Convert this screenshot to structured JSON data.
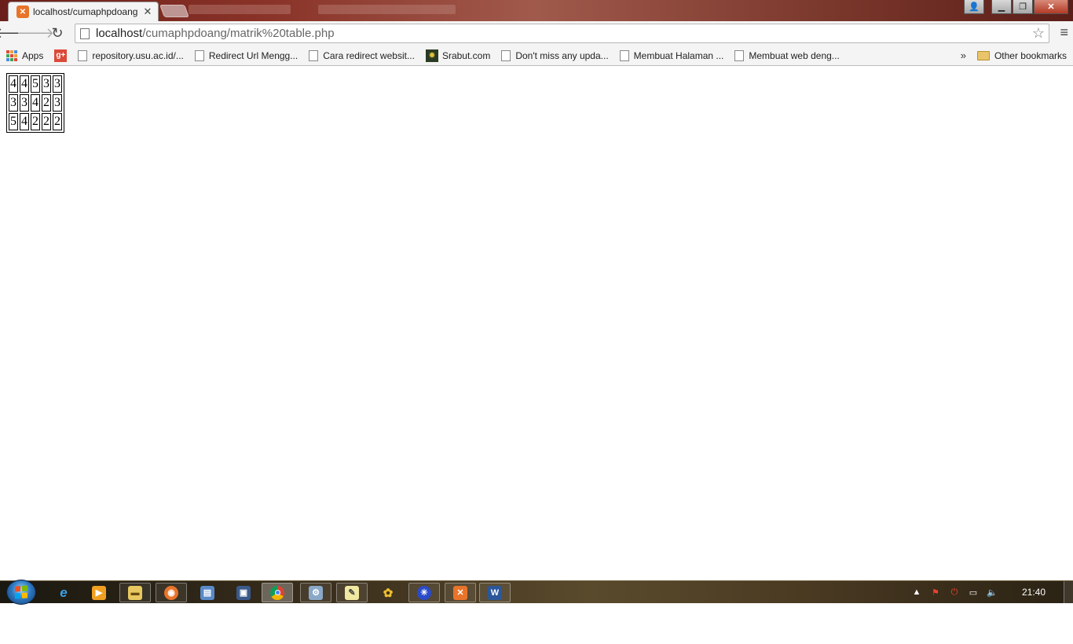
{
  "browser": {
    "tab": {
      "title": "localhost/cumaphpdoang"
    },
    "address": {
      "host": "localhost",
      "path": "/cumaphpdoang/matrik%20table.php"
    },
    "bookmarks": [
      {
        "label": "Apps",
        "icon": "apps-icon"
      },
      {
        "label": "repository.usu.ac.id/...",
        "icon": "page-icon"
      },
      {
        "label": "Redirect Url Mengg...",
        "icon": "page-icon"
      },
      {
        "label": "Cara redirect websit...",
        "icon": "page-icon"
      },
      {
        "label": "Srabut.com",
        "icon": "srabut-icon"
      },
      {
        "label": "Don't miss any upda...",
        "icon": "page-icon"
      },
      {
        "label": "Membuat Halaman ...",
        "icon": "page-icon"
      },
      {
        "label": "Membuat web deng...",
        "icon": "page-icon"
      }
    ],
    "overflow_label": "»",
    "other_bookmarks": "Other bookmarks"
  },
  "page": {
    "matrix": [
      [
        "4",
        "4",
        "5",
        "3",
        "3"
      ],
      [
        "3",
        "3",
        "4",
        "2",
        "3"
      ],
      [
        "5",
        "4",
        "2",
        "2",
        "2"
      ]
    ]
  },
  "taskbar": {
    "clock": "21:40"
  },
  "colors": {
    "xampp": "#e8742a",
    "gplus": "#dc4a38",
    "word": "#2b579a"
  }
}
